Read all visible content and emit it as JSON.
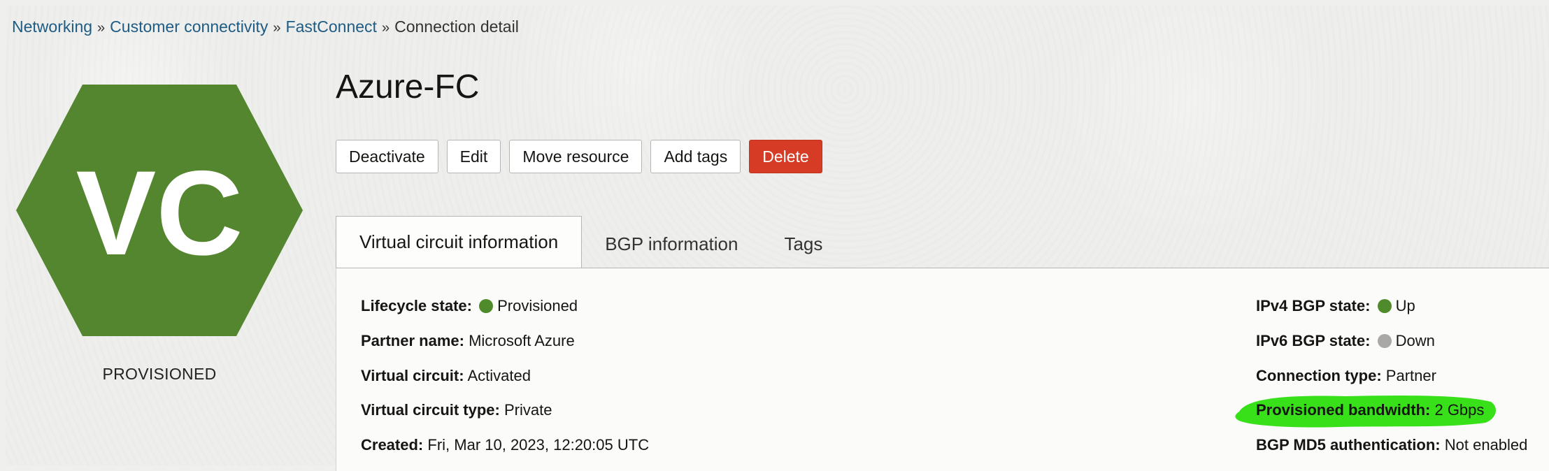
{
  "breadcrumb": {
    "items": [
      "Networking",
      "Customer connectivity",
      "FastConnect"
    ],
    "separator": "»",
    "current": "Connection detail"
  },
  "badge": {
    "icon": "hexagon-icon",
    "letters": "VC",
    "status": "PROVISIONED",
    "color": "#54852f"
  },
  "title": "Azure-FC",
  "actions": {
    "deactivate": "Deactivate",
    "edit": "Edit",
    "move": "Move resource",
    "add_tags": "Add tags",
    "delete": "Delete",
    "delete_color": "#d63b25"
  },
  "tabs": {
    "vc_info": "Virtual circuit information",
    "bgp_info": "BGP information",
    "tags": "Tags"
  },
  "details": {
    "lifecycle": {
      "label": "Lifecycle state:",
      "value": "Provisioned",
      "dot_color": "#4f8a2b"
    },
    "partner": {
      "label": "Partner name:",
      "value": "Microsoft Azure"
    },
    "vc": {
      "label": "Virtual circuit:",
      "value": "Activated"
    },
    "vc_type": {
      "label": "Virtual circuit type:",
      "value": "Private"
    },
    "created": {
      "label": "Created:",
      "value": "Fri, Mar 10, 2023, 12:20:05 UTC"
    },
    "ipv4": {
      "label": "IPv4 BGP state:",
      "value": "Up",
      "dot_color": "#4f8a2b"
    },
    "ipv6": {
      "label": "IPv6 BGP state:",
      "value": "Down",
      "dot_color": "#a9a8a6"
    },
    "conn_type": {
      "label": "Connection type:",
      "value": "Partner"
    },
    "bandwidth": {
      "label": "Provisioned bandwidth:",
      "value": "2 Gbps",
      "highlight_color": "#38e01a"
    },
    "md5": {
      "label": "BGP MD5 authentication:",
      "value": "Not enabled"
    }
  }
}
